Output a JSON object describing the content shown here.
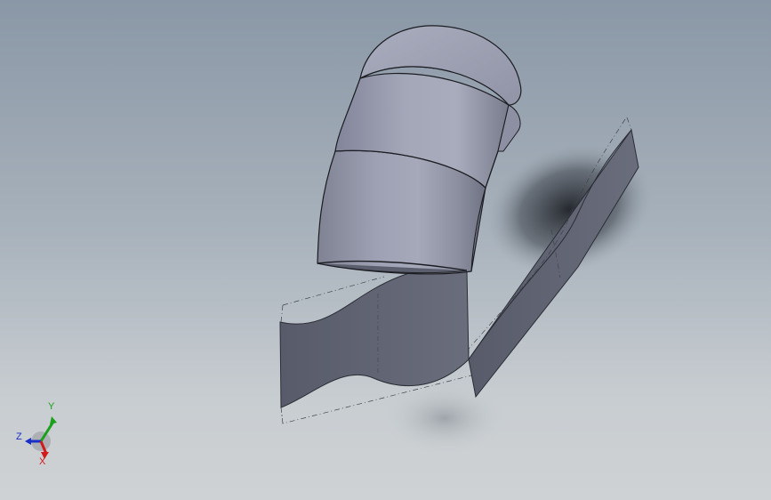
{
  "viewport": {
    "background_top": "#8a97a6",
    "background_bottom": "#cfd2d4",
    "part_color": "#9a9db0",
    "surface_color": "#5f6272"
  },
  "triad": {
    "x_label": "X",
    "y_label": "Y",
    "z_label": "Z",
    "x_color": "#d11a1a",
    "y_color": "#1aa01a",
    "z_color": "#1a2fc8"
  }
}
